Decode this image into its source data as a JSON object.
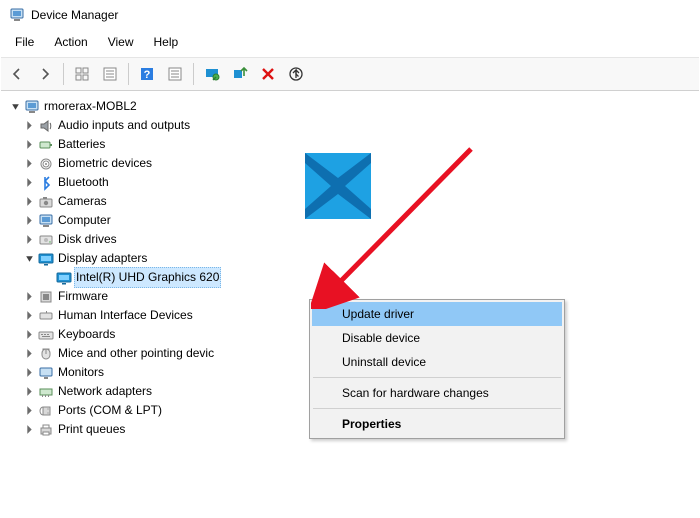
{
  "titlebar": {
    "title": "Device Manager"
  },
  "menubar": {
    "file": "File",
    "action": "Action",
    "view": "View",
    "help": "Help"
  },
  "toolbar_icons": {
    "back": "back-icon",
    "forward": "forward-icon",
    "show_hidden": "show-hidden-icon",
    "properties": "properties-icon",
    "help": "help-icon",
    "monitor": "monitor-icon",
    "scan": "scan-hardware-icon",
    "uninstall": "uninstall-icon",
    "update": "update-icon"
  },
  "tree": {
    "root": {
      "label": "rmorerax-MOBL2",
      "expanded": true
    },
    "items": [
      {
        "label": "Audio inputs and outputs",
        "icon": "audio"
      },
      {
        "label": "Batteries",
        "icon": "battery"
      },
      {
        "label": "Biometric devices",
        "icon": "biometric"
      },
      {
        "label": "Bluetooth",
        "icon": "bluetooth"
      },
      {
        "label": "Cameras",
        "icon": "camera"
      },
      {
        "label": "Computer",
        "icon": "computer"
      },
      {
        "label": "Disk drives",
        "icon": "disk"
      },
      {
        "label": "Display adapters",
        "icon": "display",
        "expanded": true,
        "children": [
          {
            "label": "Intel(R) UHD Graphics 620",
            "icon": "display",
            "selected": true
          }
        ]
      },
      {
        "label": "Firmware",
        "icon": "firmware"
      },
      {
        "label": "Human Interface Devices",
        "icon": "hid"
      },
      {
        "label": "Keyboards",
        "icon": "keyboard"
      },
      {
        "label": "Mice and other pointing devices",
        "icon": "mouse",
        "truncated": "Mice and other pointing devic"
      },
      {
        "label": "Monitors",
        "icon": "monitor"
      },
      {
        "label": "Network adapters",
        "icon": "network"
      },
      {
        "label": "Ports (COM & LPT)",
        "icon": "port"
      },
      {
        "label": "Print queues",
        "icon": "printer"
      }
    ]
  },
  "context_menu": {
    "items": [
      {
        "label": "Update driver",
        "highlight": true
      },
      {
        "label": "Disable device"
      },
      {
        "label": "Uninstall device"
      },
      {
        "sep": true
      },
      {
        "label": "Scan for hardware changes"
      },
      {
        "sep": true
      },
      {
        "label": "Properties",
        "bold": true
      }
    ]
  }
}
